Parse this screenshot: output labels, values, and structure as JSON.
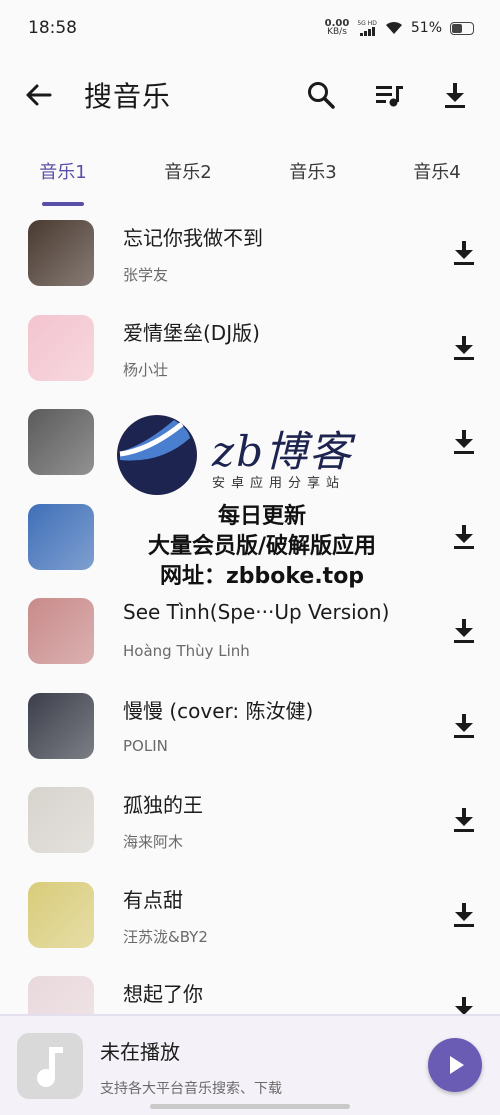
{
  "status_bar": {
    "time": "18:58",
    "net_speed_value": "0.00",
    "net_speed_unit": "KB/s",
    "signal_tag": "5G HD",
    "battery": "51%",
    "battery_level": 0.51
  },
  "header": {
    "title": "搜音乐",
    "back_icon": "arrow-left-icon",
    "search_icon": "search-icon",
    "playlist_icon": "queue-music-icon",
    "download_icon": "download-icon"
  },
  "tabs": [
    {
      "label": "音乐1",
      "active": true
    },
    {
      "label": "音乐2",
      "active": false
    },
    {
      "label": "音乐3",
      "active": false
    },
    {
      "label": "音乐4",
      "active": false
    }
  ],
  "songs": [
    {
      "title": "忘记你我做不到",
      "artist": "张学友",
      "cover_color": "#4a3a30"
    },
    {
      "title": "爱情堡垒(DJ版)",
      "artist": "杨小壮",
      "cover_color": "#f3c4cf"
    },
    {
      "title": "",
      "artist": "",
      "cover_color": "#5b5b5b"
    },
    {
      "title": "",
      "artist": "",
      "cover_color": "#3f6fb8"
    },
    {
      "title": "See Tình(Spe···Up Version)",
      "artist": "Hoàng Thùy Linh",
      "cover_color": "#c98a8a"
    },
    {
      "title": "慢慢 (cover: 陈汝健)",
      "artist": "POLIN",
      "cover_color": "#3c3f4a"
    },
    {
      "title": "孤独的王",
      "artist": "海来阿木",
      "cover_color": "#d7d3cd"
    },
    {
      "title": "有点甜",
      "artist": "汪苏泷&BY2",
      "cover_color": "#d9cc7a"
    },
    {
      "title": "想起了你",
      "artist": "",
      "cover_color": "#e8d8dc"
    }
  ],
  "watermark": {
    "brand": "zb博客",
    "tagline": "安卓应用分享站",
    "line1": "每日更新",
    "line2": "大量会员版/破解版应用",
    "line3": "网址：zbboke.top"
  },
  "player": {
    "title": "未在播放",
    "subtitle": "支持各大平台音乐搜索、下载",
    "cover_icon": "music-note-icon",
    "play_icon": "play-icon"
  },
  "colors": {
    "accent": "#5a4fa8",
    "play_button": "#6a5cb5"
  }
}
